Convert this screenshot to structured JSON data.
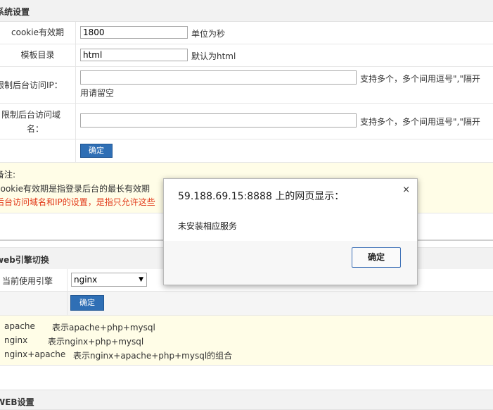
{
  "system_settings": {
    "header": "系统设置",
    "cookie": {
      "label": "cookie有效期",
      "value": "1800",
      "hint": "单位为秒"
    },
    "template_dir": {
      "label": "模板目录",
      "value": "html",
      "hint": "默认为html"
    },
    "restrict_ip": {
      "label": "限制后台访问IP：",
      "value": "",
      "hint_line1": "支持多个，多个间用逗号\",\"隔开",
      "hint_line2": "用请留空"
    },
    "restrict_domain": {
      "label_line1": "限制后台访问域",
      "label_line2": "名：",
      "value": "",
      "hint": "支持多个，多个间用逗号\",\"隔开"
    },
    "confirm_label": "确定",
    "note": {
      "title": "备注:",
      "line1": "cookie有效期是指登录后台的最长有效期",
      "line2": "后台访问域名和IP的设置，是指只允许这些"
    }
  },
  "web_engine": {
    "header": "web引擎切换",
    "current_label": "当前使用引擎",
    "selected": "nginx",
    "confirm_label": "确定",
    "notes": [
      {
        "name": "apache",
        "desc": "表示apache+php+mysql"
      },
      {
        "name": "nginx",
        "desc": "表示nginx+php+mysql"
      },
      {
        "name": "nginx+apache",
        "desc": "表示nginx+apache+php+mysql的组合"
      }
    ]
  },
  "web_settings": {
    "header": "WEB设置"
  },
  "dialog": {
    "title": "59.188.69.15:8888 上的网页显示：",
    "close": "×",
    "message": "未安装相应服务",
    "ok_label": "确定"
  }
}
